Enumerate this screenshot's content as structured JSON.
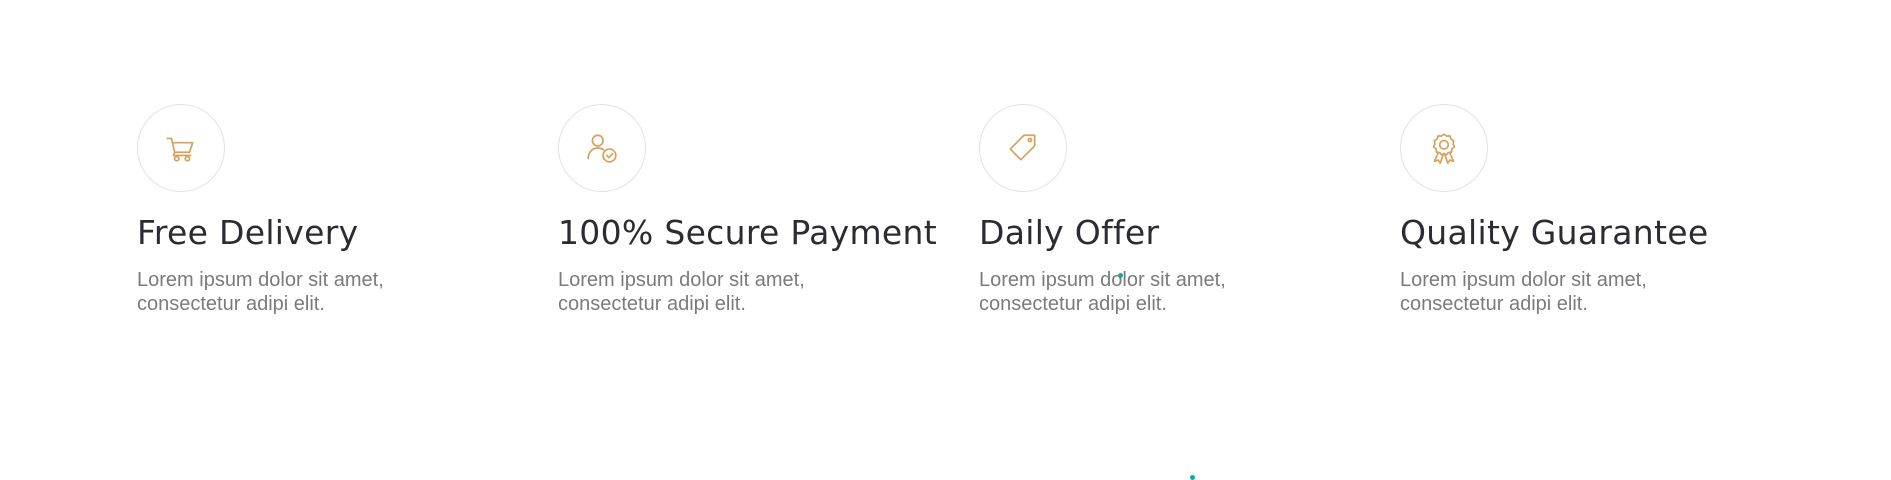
{
  "features": [
    {
      "icon": "cart-icon",
      "title": "Free Delivery",
      "description": "Lorem ipsum dolor sit amet, consectetur adipi elit."
    },
    {
      "icon": "user-check-icon",
      "title": "100% Secure Payment",
      "description": "Lorem ipsum dolor sit amet, consectetur adipi elit."
    },
    {
      "icon": "tag-icon",
      "title": "Daily Offer",
      "description": "Lorem ipsum dolor sit amet, consectetur adipi elit."
    },
    {
      "icon": "award-icon",
      "title": "Quality Guarantee",
      "description": "Lorem ipsum dolor sit amet, consectetur adipi elit."
    }
  ],
  "colors": {
    "accent": "#d9a05b",
    "title": "#2b2b33",
    "text": "#7b7b7b",
    "circle_border": "#e2e2e2",
    "dot": "#1aa7a4"
  }
}
